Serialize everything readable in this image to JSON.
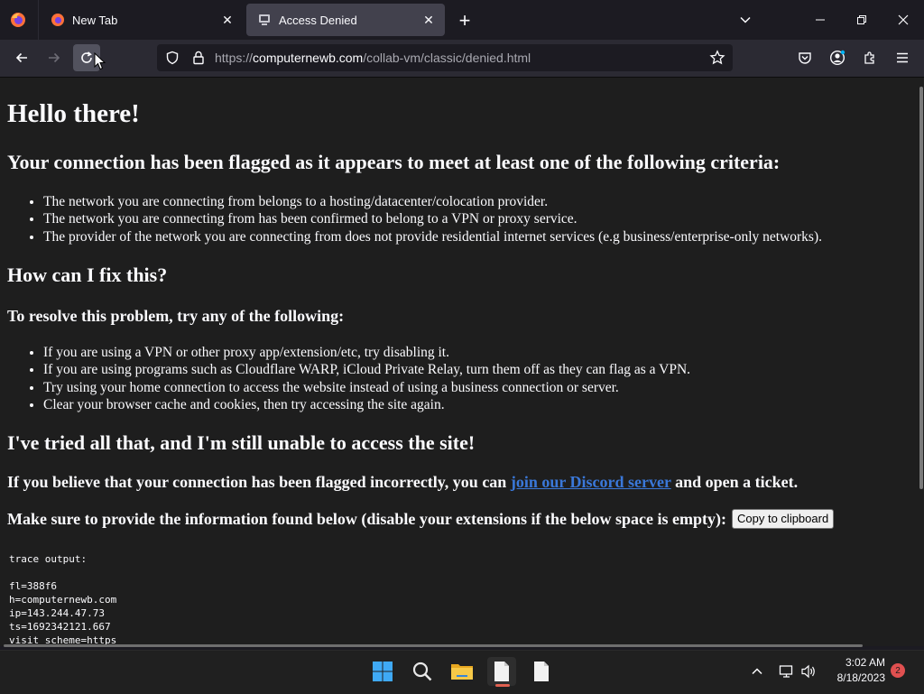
{
  "browser": {
    "tabs": [
      {
        "title": "New Tab",
        "favicon": "firefox-icon",
        "active": false
      },
      {
        "title": "Access Denied",
        "favicon": "vm-icon",
        "active": true
      }
    ],
    "url": {
      "scheme": "https://",
      "host": "computernewb.com",
      "path": "/collab-vm/classic/denied.html"
    }
  },
  "page": {
    "h1": "Hello there!",
    "h2_flagged": "Your connection has been flagged as it appears to meet at least one of the following criteria:",
    "criteria": [
      "The network you are connecting from belongs to a hosting/datacenter/colocation provider.",
      "The network you are connecting from has been confirmed to belong to a VPN or proxy service.",
      "The provider of the network you are connecting from does not provide residential internet services (e.g business/enterprise-only networks)."
    ],
    "h2_fix": "How can I fix this?",
    "h3_resolve": "To resolve this problem, try any of the following:",
    "fixes": [
      "If you are using a VPN or other proxy app/extension/etc, try disabling it.",
      "If you are using programs such as Cloudflare WARP, iCloud Private Relay, turn them off as they can flag as a VPN.",
      "Try using your home connection to access the website instead of using a business connection or server.",
      "Clear your browser cache and cookies, then try accessing the site again."
    ],
    "h2_tried": "I've tried all that, and I'm still unable to access the site!",
    "discord_pre": "If you believe that your connection has been flagged incorrectly, you can ",
    "discord_link": "join our Discord server",
    "discord_post": " and open a ticket.",
    "provide_info": "Make sure to provide the information found below (disable your extensions if the below space is empty):",
    "copy_button": "Copy to clipboard",
    "trace": "trace output:\n\nfl=388f6\nh=computernewb.com\nip=143.244.47.73\nts=1692342121.667\nvisit_scheme=https"
  },
  "taskbar": {
    "apps": [
      "windows-start-icon",
      "search-icon",
      "file-explorer-icon",
      "file-icon",
      "file-icon"
    ],
    "time": "3:02 AM",
    "date": "8/18/2023",
    "notifications": "2"
  },
  "colors": {
    "link": "#3a78d9",
    "page_bg": "#1e1e1e",
    "chrome_bg": "#2b2a33"
  }
}
